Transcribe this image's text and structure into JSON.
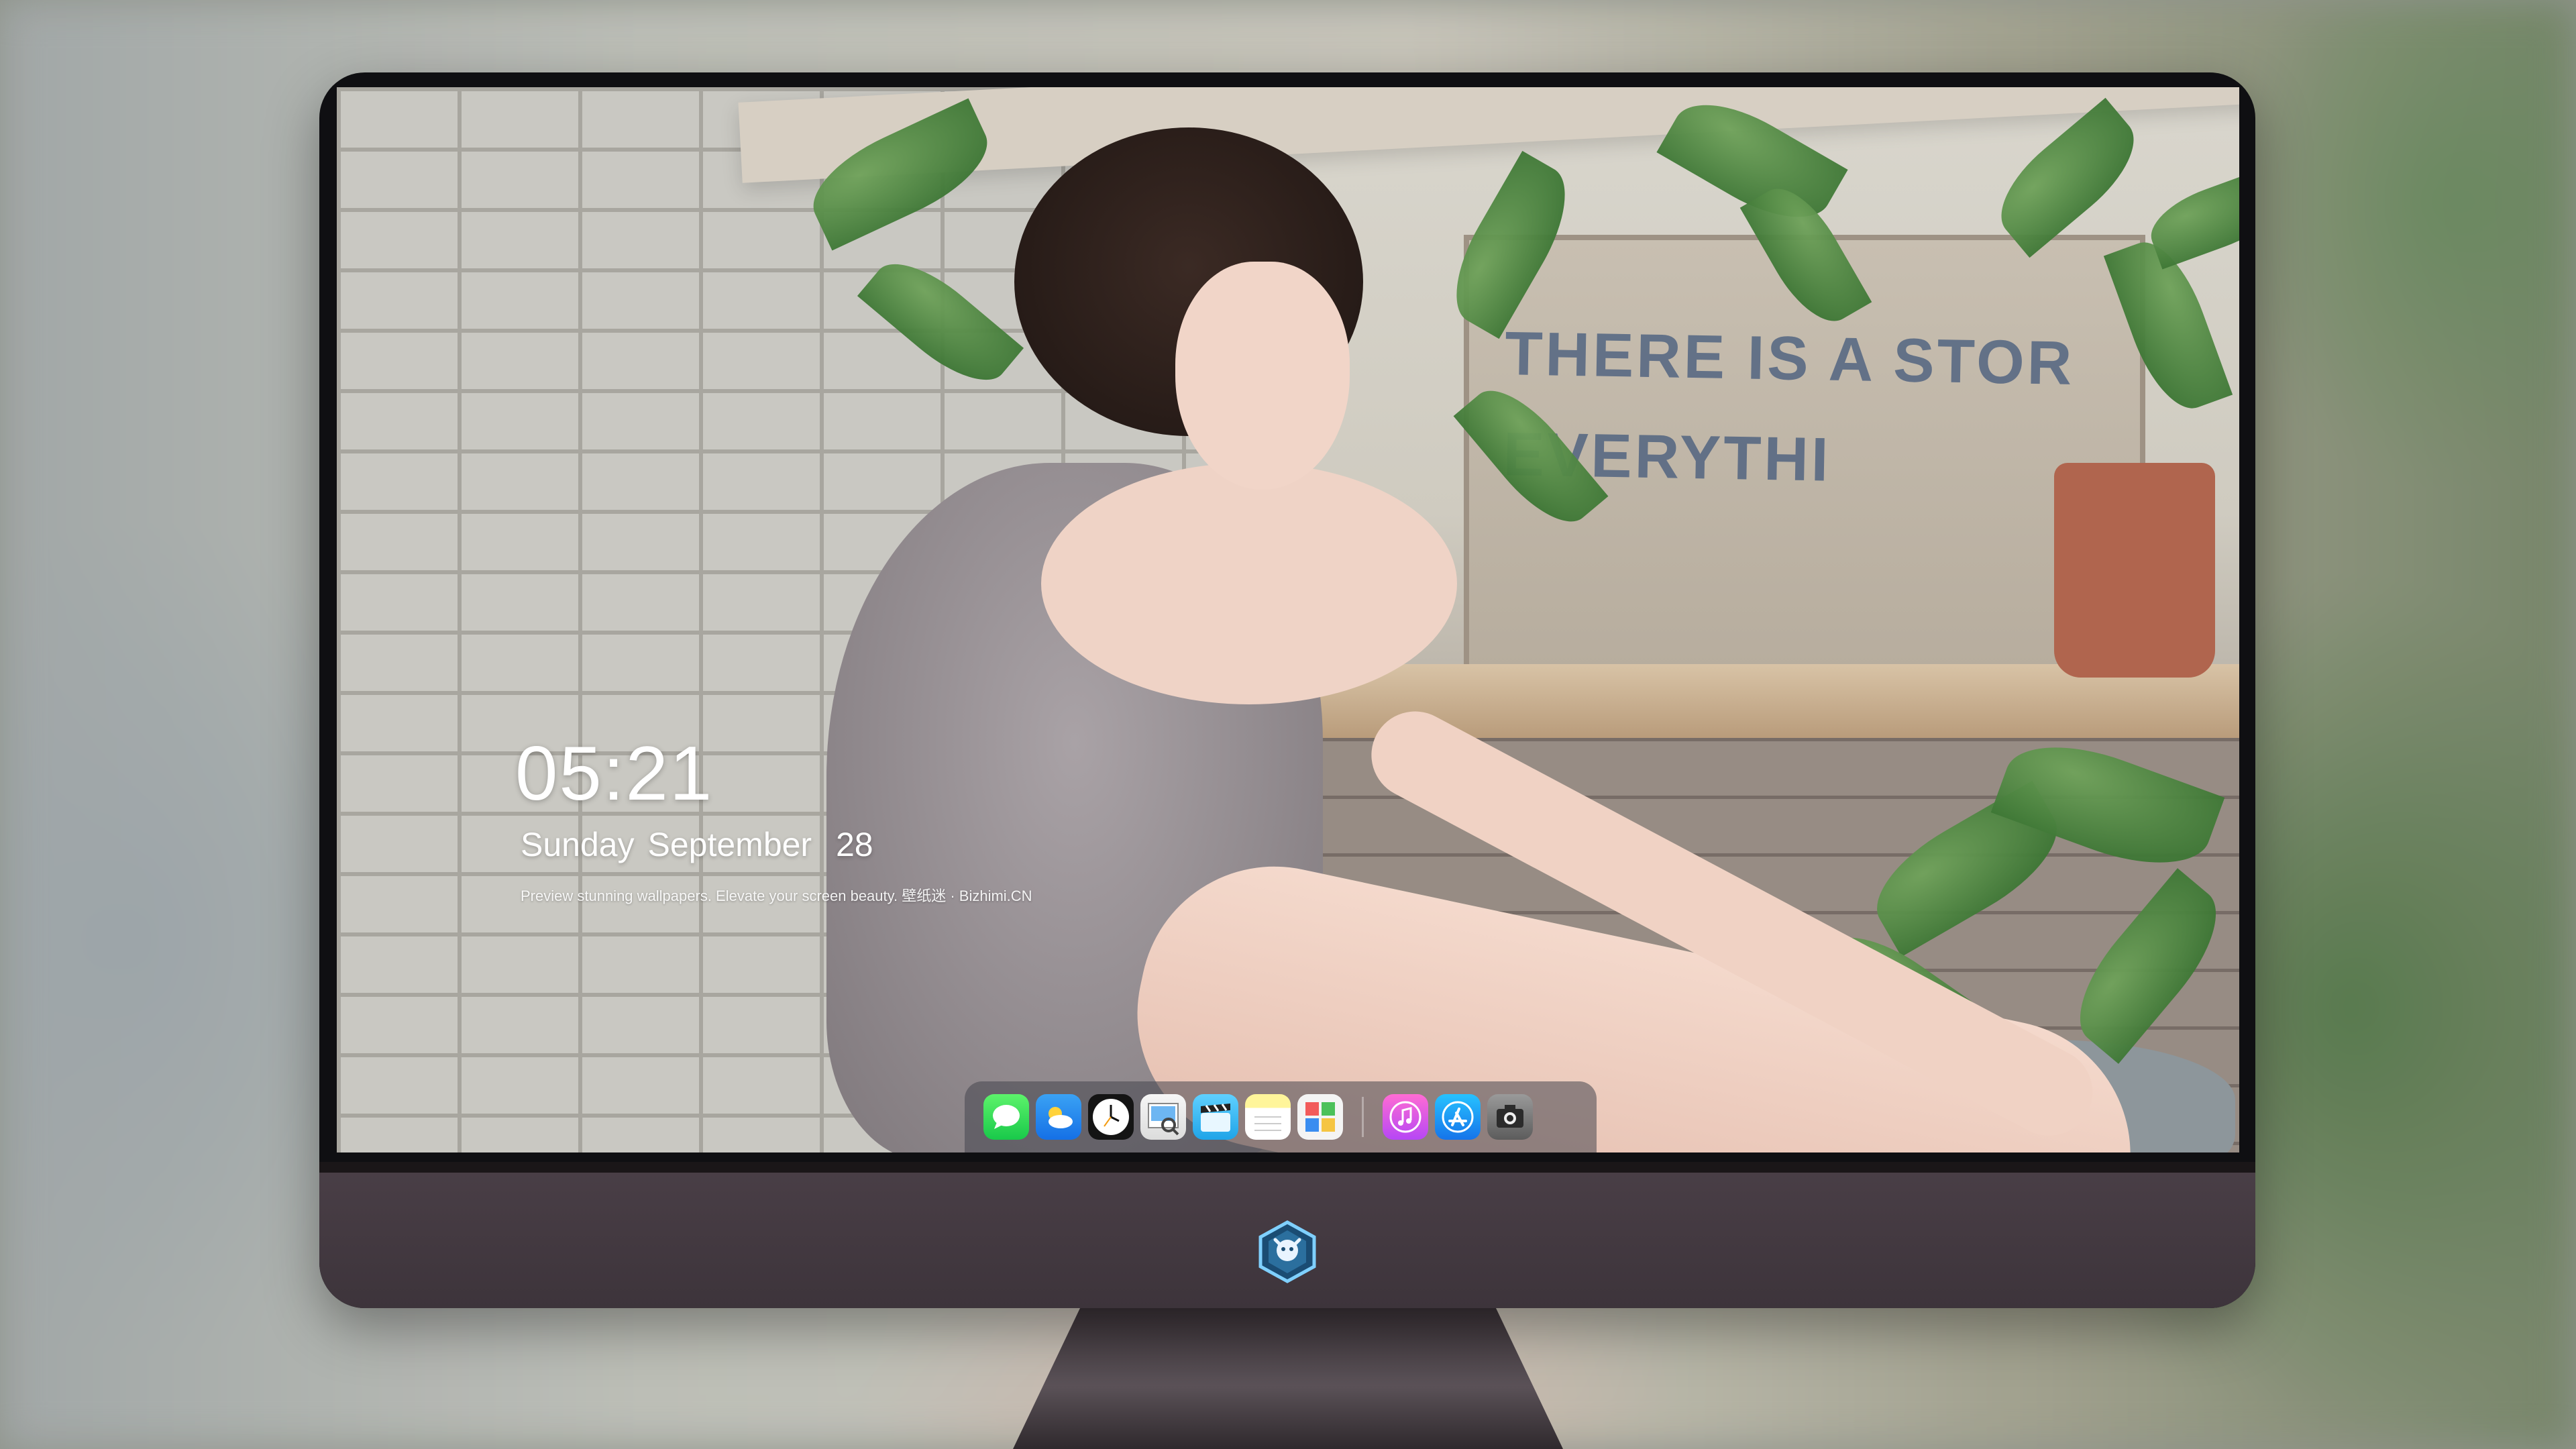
{
  "lock_screen": {
    "time": "05:21",
    "weekday": "Sunday",
    "month": "September",
    "day": "28",
    "tagline": "Preview stunning wallpapers. Elevate your screen beauty. 壁纸迷 · Bizhimi.CN"
  },
  "wallpaper": {
    "crate_text_line1": "THERE IS A STOR",
    "crate_text_line2": "EVERYTHI"
  },
  "dock": {
    "apps": [
      {
        "name": "Messages",
        "icon": "messages-icon",
        "color": "#1fd34f"
      },
      {
        "name": "Weather",
        "icon": "weather-icon",
        "color": "#2289ee"
      },
      {
        "name": "Clock",
        "icon": "clock-icon",
        "color": "#141414"
      },
      {
        "name": "Preview",
        "icon": "preview-icon",
        "color": "#e9e9e9"
      },
      {
        "name": "Clips",
        "icon": "clips-icon",
        "color": "#2fb3f0"
      },
      {
        "name": "Notes",
        "icon": "notes-icon",
        "color": "#fff59a"
      },
      {
        "name": "Photo Booth",
        "icon": "photos-icon",
        "color": "#f4f4f4"
      },
      {
        "name": "iTunes",
        "icon": "music-note-icon",
        "color": "#d55ae6"
      },
      {
        "name": "App Store",
        "icon": "app-store-icon",
        "color": "#1c93f0"
      },
      {
        "name": "Camera",
        "icon": "camera-icon",
        "color": "#7a7a7a"
      }
    ]
  },
  "monitor": {
    "logo_icon": "brand-logo-icon",
    "bezel_color": "#0f0f12",
    "chin_color": "#423840"
  }
}
